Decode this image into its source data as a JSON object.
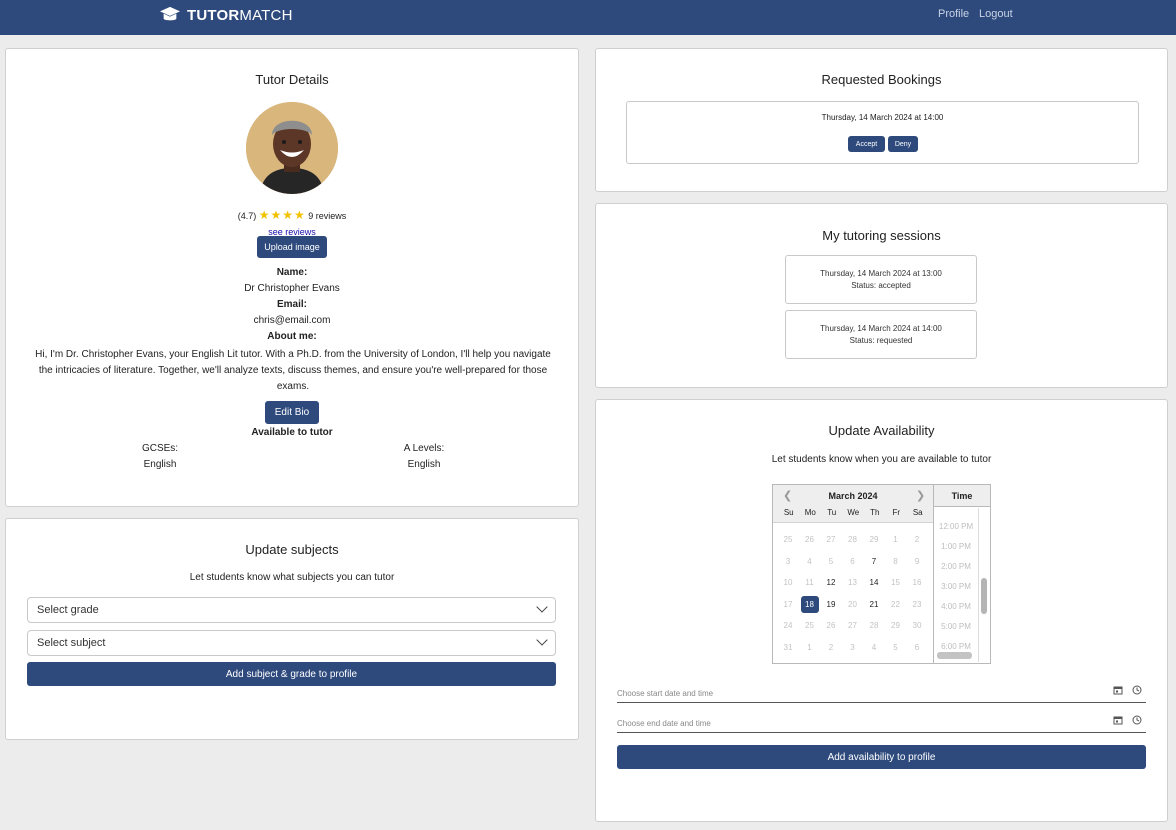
{
  "app": {
    "brand_bold": "TUTOR",
    "brand_light": "MATCH"
  },
  "nav": {
    "profile": "Profile",
    "logout": "Logout"
  },
  "tutor": {
    "title": "Tutor Details",
    "rating": "(4.7)",
    "stars": "★★★★",
    "reviews": "9 reviews",
    "see_reviews": "see reviews",
    "upload": "Upload image",
    "name_label": "Name:",
    "name": "Dr Christopher Evans",
    "email_label": "Email:",
    "email": "chris@email.com",
    "about_label": "About me:",
    "about": "Hi, I'm Dr. Christopher Evans, your English Lit tutor. With a Ph.D. from the University of London, I'll help you navigate the intricacies of literature. Together, we'll analyze texts, discuss themes, and ensure you're well-prepared for those exams.",
    "edit_bio": "Edit Bio",
    "available_label": "Available to tutor",
    "gcse_label": "GCSEs:",
    "gcse_subject": "English",
    "alevel_label": "A Levels:",
    "alevel_subject": "English"
  },
  "subjects": {
    "title": "Update subjects",
    "subtitle": "Let students know what subjects you can tutor",
    "grade_select": "Select grade",
    "subject_select": "Select subject",
    "add_button": "Add subject & grade to profile"
  },
  "requests": {
    "title": "Requested Bookings",
    "booking": "Thursday, 14 March 2024 at 14:00",
    "accept": "Accept",
    "deny": "Deny"
  },
  "sessions": {
    "title": "My tutoring sessions",
    "items": [
      {
        "when": "Thursday, 14 March 2024 at 13:00",
        "status": "Status: accepted"
      },
      {
        "when": "Thursday, 14 March 2024 at 14:00",
        "status": "Status: requested"
      }
    ]
  },
  "availability": {
    "title": "Update Availability",
    "subtitle": "Let students know when you are available to tutor",
    "calendar": {
      "month": "March 2024",
      "dow": [
        "Su",
        "Mo",
        "Tu",
        "We",
        "Th",
        "Fr",
        "Sa"
      ],
      "weeks": [
        [
          "25",
          "26",
          "27",
          "28",
          "29",
          "1",
          "2"
        ],
        [
          "3",
          "4",
          "5",
          "6",
          "7",
          "8",
          "9"
        ],
        [
          "10",
          "11",
          "12",
          "13",
          "14",
          "15",
          "16"
        ],
        [
          "17",
          "18",
          "19",
          "20",
          "21",
          "22",
          "23"
        ],
        [
          "24",
          "25",
          "26",
          "27",
          "28",
          "29",
          "30"
        ],
        [
          "31",
          "1",
          "2",
          "3",
          "4",
          "5",
          "6"
        ]
      ],
      "selected_day": "18",
      "time_header": "Time",
      "times": [
        "12:00 PM",
        "1:00 PM",
        "2:00 PM",
        "3:00 PM",
        "4:00 PM",
        "5:00 PM",
        "6:00 PM"
      ]
    },
    "start_placeholder": "Choose start date and time",
    "end_placeholder": "Choose end date and time",
    "add_button": "Add availability to profile"
  }
}
